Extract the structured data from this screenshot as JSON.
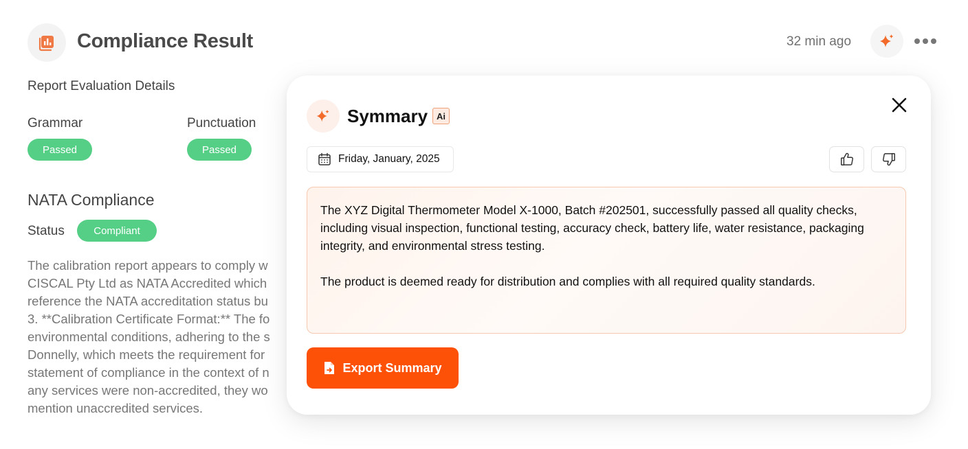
{
  "header": {
    "title": "Compliance Result",
    "icon": "report-chart-icon",
    "time_ago": "32 min ago",
    "ai_action_icon": "sparkle-icon",
    "more_icon": "more-horizontal-icon"
  },
  "evaluation": {
    "subtitle": "Report Evaluation Details",
    "checks": [
      {
        "label": "Grammar",
        "status": "Passed"
      },
      {
        "label": "Punctuation",
        "status": "Passed"
      }
    ]
  },
  "nata": {
    "title": "NATA Compliance",
    "status_label": "Status",
    "status_value": "Compliant",
    "body_lines": [
      "The calibration report appears to comply w",
      "CISCAL Pty Ltd as NATA Accredited which",
      "reference the NATA accreditation status bu",
      "3. **Calibration Certificate Format:** The fo",
      "environmental conditions, adhering to the s",
      "Donnelly, which meets the requirement for",
      "statement of compliance in the context of n",
      "any services were non-accredited, they wo",
      "mention unaccredited services."
    ]
  },
  "summary_modal": {
    "title": "Symmary",
    "ai_badge": "Ai",
    "title_icon": "sparkle-icon",
    "close_icon": "close-icon",
    "date": "Friday, January, 2025",
    "date_icon": "calendar-icon",
    "like_icon": "thumbs-up-icon",
    "dislike_icon": "thumbs-down-icon",
    "paragraphs": [
      "The XYZ Digital Thermometer Model X-1000, Batch #202501, successfully passed all quality checks, including visual inspection, functional testing, accuracy check, battery life, water resistance, packaging integrity, and environmental stress testing.",
      "The product is deemed ready for distribution and complies with all required quality standards."
    ],
    "export_label": "Export Summary",
    "export_icon": "export-file-icon"
  },
  "colors": {
    "accent": "#fd5108",
    "success": "#56cf86",
    "summary_border": "#f6c9b0"
  }
}
